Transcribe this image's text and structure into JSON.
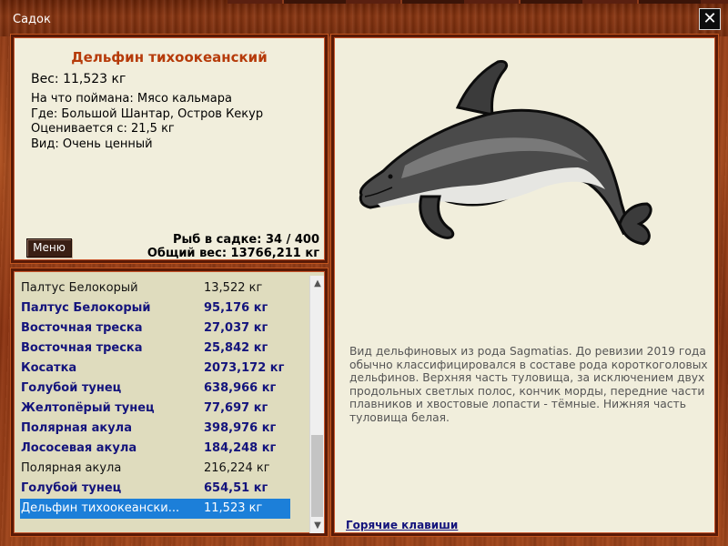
{
  "window": {
    "title": "Садок",
    "close_glyph": "✕"
  },
  "fish": {
    "name": "Дельфин тихоокеанский",
    "weight_line": "Вес: 11,523 кг",
    "bait_line": "На что поймана: Мясо кальмара",
    "place_line": "Где: Большой Шантар, Остров Кекур",
    "value_line": "Оценивается с: 21,5 кг",
    "kind_line": "Вид: Очень ценный"
  },
  "menu_button": "Меню",
  "stats": {
    "count_line": "Рыб в садке: 34 / 400",
    "total_weight_line": "Общий вес: 13766,211 кг"
  },
  "catch_list": [
    {
      "name": "Палтус Белокорый",
      "weight": "13,522 кг",
      "style": "normal"
    },
    {
      "name": "Палтус Белокорый",
      "weight": "95,176 кг",
      "style": "valuable"
    },
    {
      "name": "Восточная треска",
      "weight": "27,037 кг",
      "style": "valuable"
    },
    {
      "name": "Восточная треска",
      "weight": "25,842 кг",
      "style": "valuable"
    },
    {
      "name": "Косатка",
      "weight": "2073,172 кг",
      "style": "valuable"
    },
    {
      "name": "Голубой тунец",
      "weight": "638,966 кг",
      "style": "valuable"
    },
    {
      "name": "Желтопёрый тунец",
      "weight": "77,697 кг",
      "style": "valuable"
    },
    {
      "name": "Полярная акула",
      "weight": "398,976 кг",
      "style": "valuable"
    },
    {
      "name": "Лососевая акула",
      "weight": "184,248 кг",
      "style": "valuable"
    },
    {
      "name": "Полярная акула",
      "weight": "216,224 кг",
      "style": "normal"
    },
    {
      "name": "Голубой тунец",
      "weight": "654,51 кг",
      "style": "valuable"
    },
    {
      "name": "Дельфин тихоокeански...",
      "weight": "11,523 кг",
      "style": "selected"
    }
  ],
  "description": "Вид дельфиновых из рода Sagmatias. До ревизии 2019 года обычно классифицировался в составе рода короткоголовых дельфинов. Верхняя часть туловища, за исключением двух продольных светлых полос, кончик морды, передние части плавников и хвостовые лопасти - тёмные. Нижняя часть туловища белая.",
  "hotkeys_link": "Горячие клавиши",
  "icons": {
    "close": "close-icon",
    "scroll_up": "chevron-up-icon",
    "scroll_down": "chevron-down-icon"
  },
  "colors": {
    "fish_name": "#b63b0a",
    "valuable_text": "#14147c",
    "selected_row": "#1c7fd9"
  }
}
